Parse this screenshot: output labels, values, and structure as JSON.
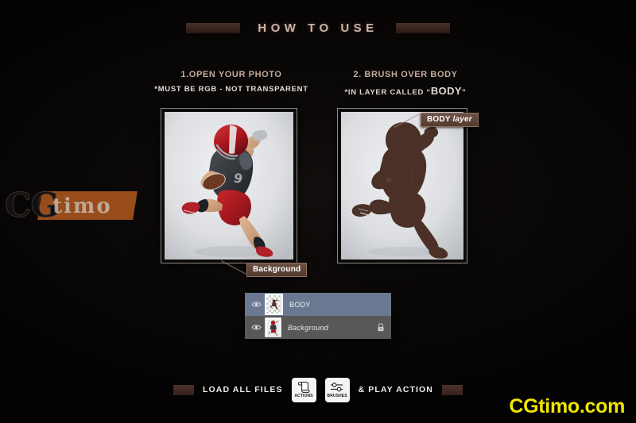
{
  "header": {
    "title": "HOW TO USE",
    "left_bar": "decorative-bar",
    "right_bar": "decorative-bar"
  },
  "steps": [
    {
      "heading": "1.OPEN YOUR PHOTO",
      "note_prefix": "*MUST BE RGB - NOT TRANSPARENT",
      "note_emphasis": "",
      "note_suffix": "",
      "callout": "Background",
      "callout_italic": ""
    },
    {
      "heading": "2. BRUSH OVER BODY",
      "note_prefix": "*IN LAYER CALLED “",
      "note_emphasis": "BODY",
      "note_suffix": "”",
      "callout": "BODY ",
      "callout_italic": "layer"
    }
  ],
  "layers_panel": {
    "rows": [
      {
        "name": "BODY",
        "selected": true,
        "locked": false,
        "visible": true,
        "thumb_type": "transparent"
      },
      {
        "name": "Background",
        "selected": false,
        "locked": true,
        "visible": true,
        "thumb_type": "opaque"
      }
    ]
  },
  "bottom_bar": {
    "left_label": "LOAD ALL FILES",
    "right_label": "& PLAY ACTION",
    "buttons": [
      {
        "caption": "ACTIONS",
        "icon": "scroll-icon"
      },
      {
        "caption": "BRUSHES",
        "icon": "sliders-icon"
      }
    ]
  },
  "watermarks": {
    "side_cg": "CG",
    "side_timo": "timo",
    "corner": "CGtimo.com"
  },
  "colors": {
    "background": "#050403",
    "accent_brown": "#6d5145",
    "title_text": "#cdb4a7",
    "layer_selected": "#6a7991",
    "layer_normal": "#585858",
    "corner_yellow": "#f2e600",
    "silhouette": "#4a3026"
  }
}
